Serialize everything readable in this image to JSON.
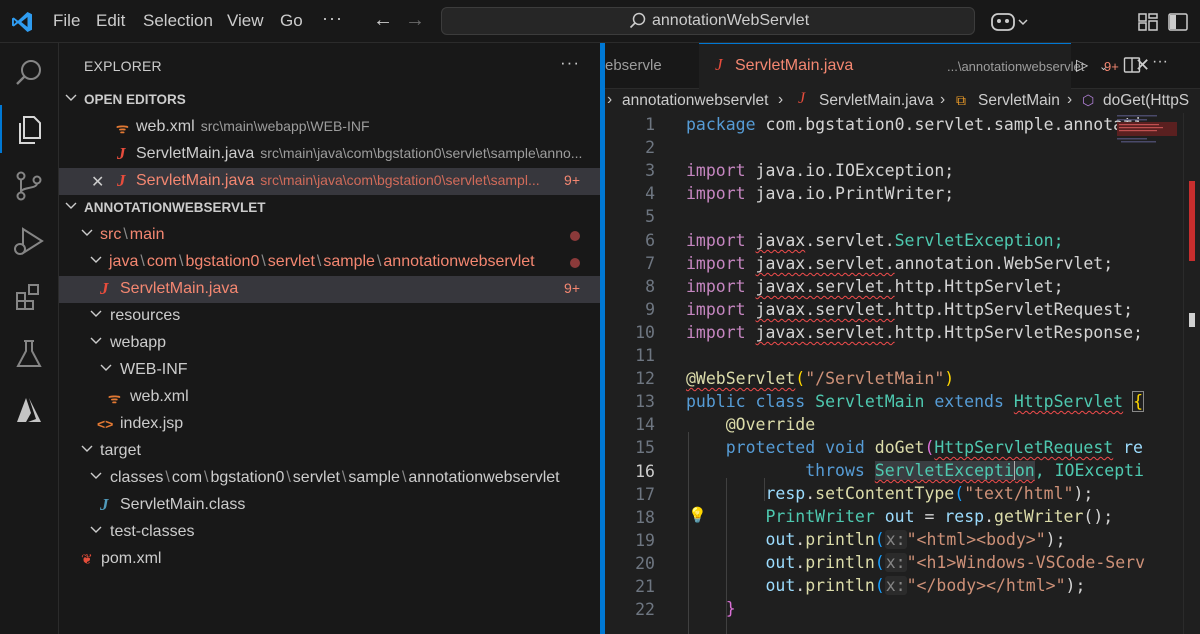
{
  "titlebar": {
    "menus": [
      "File",
      "Edit",
      "Selection",
      "View",
      "Go"
    ],
    "more": "···",
    "command_center": "annotationWebServlet"
  },
  "explorer": {
    "header": "EXPLORER",
    "more": "···",
    "open_editors_label": "OPEN EDITORS",
    "open_editors": [
      {
        "name": "web.xml",
        "path": "src\\main\\webapp\\WEB-INF"
      },
      {
        "name": "ServletMain.java",
        "path": "src\\main\\java\\com\\bgstation0\\servlet\\sample\\anno..."
      },
      {
        "name": "ServletMain.java",
        "path": "src\\main\\java\\com\\bgstation0\\servlet\\sampl...",
        "badge": "9+"
      }
    ],
    "project_label": "ANNOTATIONWEBSERVLET",
    "tree": {
      "src": [
        "src",
        "main"
      ],
      "java": [
        "java",
        "com",
        "bgstation0",
        "servlet",
        "sample",
        "annotationwebservlet"
      ],
      "servletmain": "ServletMain.java",
      "servletmain_badge": "9+",
      "resources": "resources",
      "webapp": "webapp",
      "webinf": "WEB-INF",
      "webxml": "web.xml",
      "indexjsp": "index.jsp",
      "target": "target",
      "classes": [
        "classes",
        "com",
        "bgstation0",
        "servlet",
        "sample",
        "annotationwebservlet"
      ],
      "servletmain_class": "ServletMain.class",
      "testclasses": "test-classes",
      "pom": "pom.xml"
    }
  },
  "editor": {
    "prev_tab": "ebservle",
    "active_tab": {
      "name": "ServletMain.java",
      "desc": "...\\annotationwebservlet",
      "badge": "9+"
    },
    "breadcrumb": [
      "annotationwebservlet",
      "ServletMain.java",
      "ServletMain",
      "doGet(HttpS"
    ],
    "line_numbers": [
      "1",
      "2",
      "3",
      "4",
      "5",
      "6",
      "7",
      "8",
      "9",
      "10",
      "11",
      "12",
      "13",
      "14",
      "15",
      "16",
      "17",
      "18",
      "19",
      "20",
      "21",
      "22"
    ],
    "code": {
      "l1a": "package",
      "l1b": " com.bgstation0.servlet.sample.annotati",
      "l3a": "import",
      "l3b": " java.io.IOException;",
      "l4a": "import",
      "l4b": " java.io.PrintWriter;",
      "l6a": "import",
      "l6b": "javax",
      "l6c": ".servlet.",
      "l6d": "ServletException;",
      "l7a": "import",
      "l7b": "javax",
      "l7c": ".servlet.",
      "l7d": "annotation.WebServlet;",
      "l8a": "import",
      "l8b": "javax",
      "l8c": ".servlet.",
      "l8d": "http.HttpServlet;",
      "l9a": "import",
      "l9b": "javax",
      "l9c": ".servlet.",
      "l9d": "http.HttpServletRequest;",
      "l10a": "import",
      "l10b": "javax",
      "l10c": ".servlet.",
      "l10d": "http.HttpServletResponse;",
      "l12a": "@WebServlet",
      "l12b": "(",
      "l12c": "\"/ServletMain\"",
      "l12d": ")",
      "l13a": "public class",
      "l13b": " ServletMain ",
      "l13c": "extends",
      "l13d": "HttpServlet",
      "l13e": "{",
      "l14a": "@Override",
      "l15a": "protected void",
      "l15b": " doGet",
      "l15c": "(",
      "l15d": "HttpServletRequest",
      "l15e": " re",
      "l16a": "throws",
      "l16b": "ServletExcepti",
      "l16c": "on",
      "l16d": ", IOExcepti",
      "l17a": "resp",
      "l17b": ".",
      "l17c": "setContentType",
      "l17d": "(",
      "l17e": "\"text/html\"",
      "l17f": ");",
      "l18a": "PrintWriter",
      "l18b": " out",
      "l18c": " = ",
      "l18d": "resp",
      "l18e": ".",
      "l18f": "getWriter",
      "l18g": "();",
      "l19a": "out",
      "l19b": ".",
      "l19c": "println",
      "l19d": "(",
      "l19e": "x:",
      "l19f": "\"<html><body>\"",
      "l19g": ");",
      "l20a": "out",
      "l20b": ".",
      "l20c": "println",
      "l20d": "(",
      "l20e": "x:",
      "l20f": "\"<h1>Windows-VSCode-Serv",
      "l21a": "out",
      "l21b": ".",
      "l21c": "println",
      "l21d": "(",
      "l21e": "x:",
      "l21f": "\"</body></html>\"",
      "l21g": ");",
      "l22a": "}"
    }
  },
  "colors": {
    "accent": "#0078d4",
    "error": "#f48771",
    "keyword": "#569cd6",
    "type": "#4ec9b0"
  }
}
